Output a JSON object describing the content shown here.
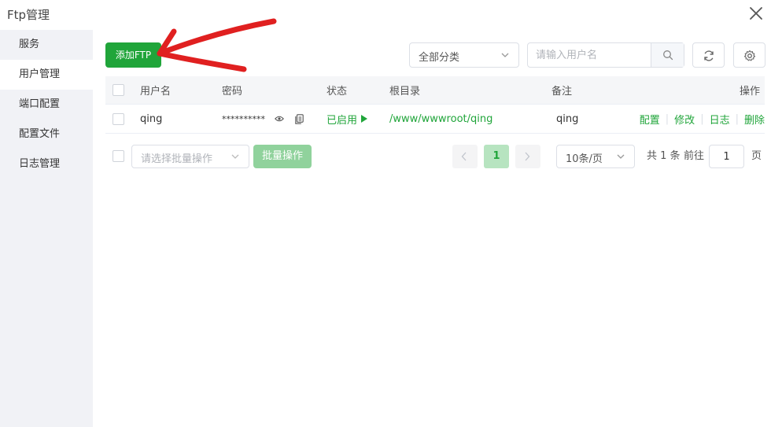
{
  "window": {
    "title": "Ftp管理"
  },
  "sidebar": {
    "items": [
      {
        "label": "服务",
        "active": false
      },
      {
        "label": "用户管理",
        "active": true
      },
      {
        "label": "端口配置",
        "active": false
      },
      {
        "label": "配置文件",
        "active": false
      },
      {
        "label": "日志管理",
        "active": false
      }
    ]
  },
  "toolbar": {
    "add_label": "添加FTP",
    "category_selected": "全部分类",
    "search_placeholder": "请输入用户名"
  },
  "table": {
    "headers": {
      "username": "用户名",
      "password": "密码",
      "status": "状态",
      "root": "根目录",
      "note": "备注",
      "ops": "操作"
    },
    "rows": [
      {
        "username": "qing",
        "password": "**********",
        "status": "已启用",
        "root": "/www/wwwroot/qing",
        "note": "qing",
        "ops": [
          "配置",
          "修改",
          "日志",
          "删除"
        ]
      }
    ]
  },
  "footer": {
    "batch_placeholder": "请选择批量操作",
    "batch_button": "批量操作",
    "current_page": "1",
    "page_size": "10条/页",
    "total_text": "共 1 条",
    "goto_prefix": "前往",
    "goto_value": "1",
    "goto_suffix": "页"
  },
  "colors": {
    "accent": "#20a53a",
    "annotation_arrow": "#e02020"
  }
}
